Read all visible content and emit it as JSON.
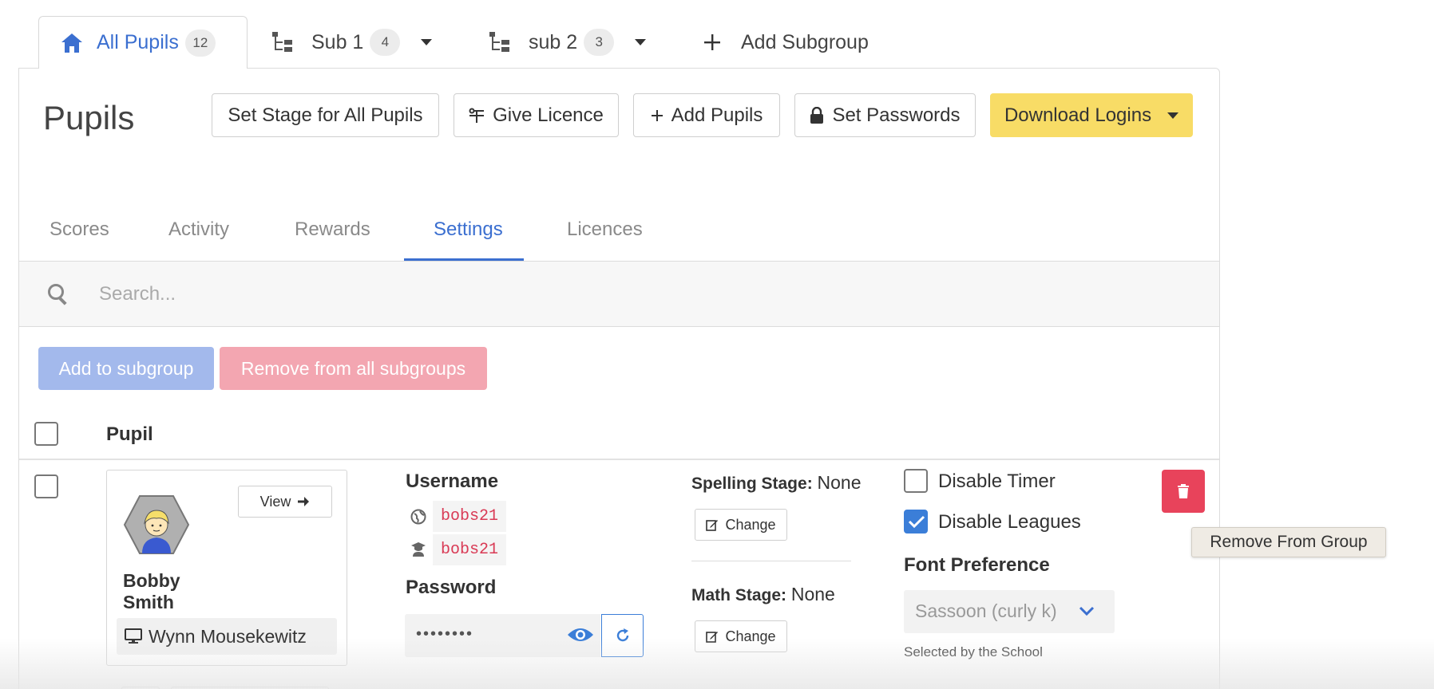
{
  "group_tabs": [
    {
      "label": "All Pupils",
      "count": "12",
      "icon": "home-icon"
    },
    {
      "label": "Sub 1",
      "count": "4",
      "icon": "subgroup-icon"
    },
    {
      "label": "sub 2",
      "count": "3",
      "icon": "subgroup-icon"
    },
    {
      "label": "Add Subgroup",
      "icon": "plus-icon"
    }
  ],
  "page_title": "Pupils",
  "toolbar": {
    "set_stage": "Set Stage for All Pupils",
    "give_licence": "Give Licence",
    "add_pupils": "Add Pupils",
    "set_passwords": "Set Passwords",
    "download_logins": "Download Logins"
  },
  "view_tabs": [
    "Scores",
    "Activity",
    "Rewards",
    "Settings",
    "Licences"
  ],
  "active_view_tab": "Settings",
  "search": {
    "placeholder": "Search..."
  },
  "actions": {
    "add_to_subgroup": "Add to subgroup",
    "remove_from_all": "Remove from all subgroups"
  },
  "table": {
    "pupil_header": "Pupil"
  },
  "pupil": {
    "first_name": "Bobby",
    "last_name": "Smith",
    "view_label": "View",
    "device_name": "Wynn Mousekewitz",
    "username_label": "Username",
    "username_global": "bobs21",
    "username_class": "bobs21",
    "password_label": "Password",
    "password_masked": "••••••••",
    "spelling_stage_label": "Spelling Stage:",
    "spelling_stage_value": "None",
    "math_stage_label": "Math Stage:",
    "math_stage_value": "None",
    "change_label": "Change",
    "disable_timer": "Disable Timer",
    "disable_timer_checked": false,
    "disable_leagues": "Disable Leagues",
    "disable_leagues_checked": true,
    "font_pref_label": "Font Preference",
    "font_pref_value": "Sassoon (curly k)",
    "font_pref_note": "Selected by the School"
  },
  "tooltip": "Remove From Group",
  "colors": {
    "accent": "#3b6fd0",
    "download": "#f8dc66",
    "delete": "#e8435b",
    "add_subgroup_btn": "#a3b9ec",
    "remove_subgroups_btn": "#f3a6b1"
  }
}
